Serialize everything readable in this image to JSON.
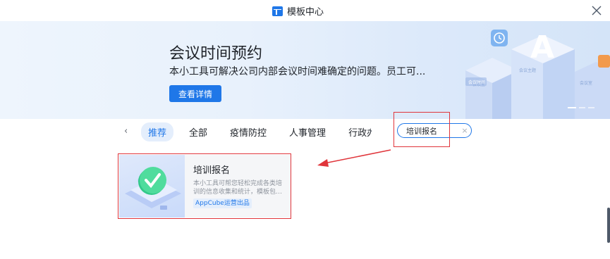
{
  "window": {
    "title": "模板中心"
  },
  "banner": {
    "title": "会议时间预约",
    "description": "本小工具可解决公司内部会议时间难确定的问题。员工可...",
    "button_label": "查看详情",
    "art_labels": {
      "sign_a": "A",
      "label_1": "会议室",
      "label_2": "会议主题",
      "label_3": "会议时间",
      "label_4": "会议室"
    }
  },
  "tabs": [
    {
      "label": "推荐",
      "active": true
    },
    {
      "label": "全部",
      "active": false
    },
    {
      "label": "疫情防控",
      "active": false
    },
    {
      "label": "人事管理",
      "active": false
    },
    {
      "label": "行政办公",
      "active": false
    }
  ],
  "nav": {
    "prev_arrow": "‹",
    "next_arrow": "›"
  },
  "search": {
    "value": "培训报名",
    "clear_icon": "×"
  },
  "card": {
    "title": "培训报名",
    "description": "本小工具可帮您轻松完成各类培训的信息收集和统计，模板包含员...",
    "tag": "AppCube运营出品"
  },
  "colors": {
    "accent": "#1f77e8",
    "annotation": "#e0353b"
  }
}
